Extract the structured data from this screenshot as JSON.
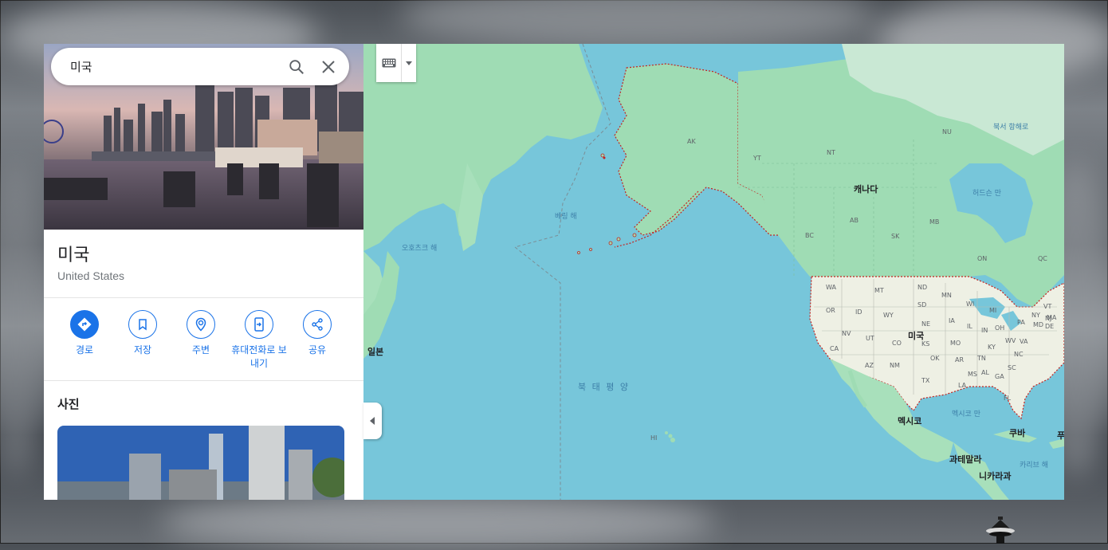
{
  "search": {
    "query": "미국"
  },
  "place": {
    "title": "미국",
    "subtitle": "United States"
  },
  "actions": [
    {
      "label": "경로",
      "icon": "directions-icon"
    },
    {
      "label": "저장",
      "icon": "bookmark-icon"
    },
    {
      "label": "주변",
      "icon": "nearby-icon"
    },
    {
      "label": "휴대전화로 보내기",
      "icon": "send-to-phone-icon"
    },
    {
      "label": "공유",
      "icon": "share-icon"
    }
  ],
  "photos": {
    "title": "사진"
  },
  "map": {
    "countries": [
      "미국",
      "캐나다",
      "멕시코",
      "일본",
      "쿠바",
      "과테말라",
      "니카라과"
    ],
    "states_us": [
      "WA",
      "OR",
      "ID",
      "MT",
      "WY",
      "ND",
      "SD",
      "NE",
      "MN",
      "WI",
      "MI",
      "IA",
      "IL",
      "IN",
      "OH",
      "PA",
      "NY",
      "NV",
      "CA",
      "UT",
      "CO",
      "KS",
      "MO",
      "KY",
      "WV",
      "VA",
      "NC",
      "TN",
      "AR",
      "OK",
      "TX",
      "NM",
      "AZ",
      "MS",
      "AL",
      "GA",
      "SC",
      "LA",
      "FL",
      "MD",
      "DE",
      "NJ",
      "MA",
      "VT",
      "HI",
      "AK"
    ],
    "provinces_ca": [
      "YT",
      "NT",
      "NU",
      "BC",
      "AB",
      "SK",
      "MB",
      "ON",
      "QC"
    ],
    "water": [
      "베링 해",
      "오호츠크 해",
      "허드슨 만",
      "북서 항해로",
      "멕시코 만",
      "카리브 해"
    ],
    "ocean": "북 태 평 양",
    "partial_label": "푸"
  },
  "colors": {
    "accent": "#1a73e8",
    "water": "#77c6da",
    "land": "#9fdcb4",
    "us_land": "#eef0e4",
    "border": "#c5221f"
  }
}
